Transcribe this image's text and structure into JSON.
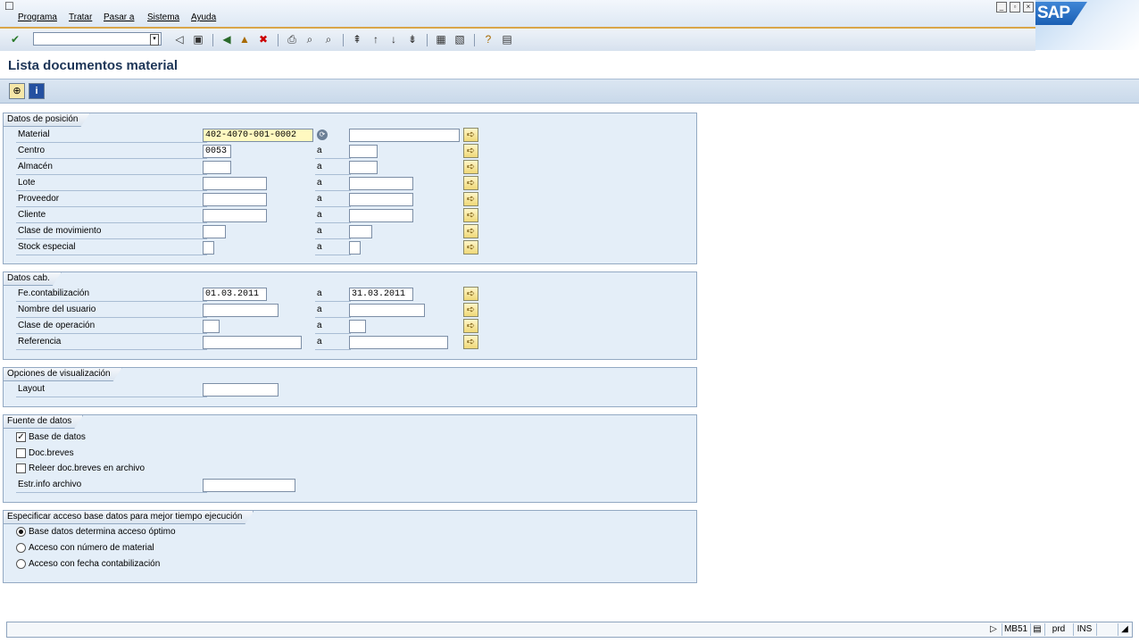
{
  "menu": {
    "items": [
      "Programa",
      "Tratar",
      "Pasar a",
      "Sistema",
      "Ayuda"
    ],
    "logo": "SAP"
  },
  "toolbar": {
    "command_value": "",
    "icons": [
      "enter-icon",
      "back-icon",
      "save-icon",
      "back-nav-icon",
      "exit-icon",
      "cancel-icon",
      "print-icon",
      "find-icon",
      "find-next-icon",
      "first-page-icon",
      "prev-page-icon",
      "next-page-icon",
      "last-page-icon",
      "new-session-icon",
      "shortcut-icon",
      "help-icon",
      "customize-icon"
    ]
  },
  "page": {
    "title": "Lista documentos material"
  },
  "sections": {
    "posicion": {
      "title": "Datos de posición",
      "rows": [
        {
          "label": "Material",
          "from": "402-4070-001-0002",
          "to": ""
        },
        {
          "label": "Centro",
          "from": "0053",
          "to": ""
        },
        {
          "label": "Almacén",
          "from": "",
          "to": ""
        },
        {
          "label": "Lote",
          "from": "",
          "to": ""
        },
        {
          "label": "Proveedor",
          "from": "",
          "to": ""
        },
        {
          "label": "Cliente",
          "from": "",
          "to": ""
        },
        {
          "label": "Clase de movimiento",
          "from": "",
          "to": ""
        },
        {
          "label": "Stock especial",
          "from": "",
          "to": ""
        }
      ]
    },
    "cabecera": {
      "title": "Datos cab.",
      "rows": [
        {
          "label": "Fe.contabilización",
          "from": "01.03.2011",
          "to": "31.03.2011"
        },
        {
          "label": "Nombre del usuario",
          "from": "",
          "to": ""
        },
        {
          "label": "Clase de operación",
          "from": "",
          "to": ""
        },
        {
          "label": "Referencia",
          "from": "",
          "to": ""
        }
      ]
    },
    "visualizacion": {
      "title": "Opciones de visualización",
      "layout_label": "Layout",
      "layout_value": ""
    },
    "fuente": {
      "title": "Fuente de datos",
      "checks": [
        {
          "label": "Base de datos",
          "checked": true
        },
        {
          "label": "Doc.breves",
          "checked": false
        },
        {
          "label": "Releer doc.breves en archivo",
          "checked": false
        }
      ],
      "estr_label": "Estr.info archivo",
      "estr_value": ""
    },
    "acceso": {
      "title": "Especificar acceso base datos para mejor tiempo ejecución",
      "radios": [
        {
          "label": "Base datos determina acceso óptimo",
          "selected": true
        },
        {
          "label": "Acceso con número de material",
          "selected": false
        },
        {
          "label": "Acceso con fecha contabilización",
          "selected": false
        }
      ]
    }
  },
  "range_sep": "a",
  "statusbar": {
    "transaction": "MB51",
    "system": "prd",
    "mode": "INS"
  }
}
